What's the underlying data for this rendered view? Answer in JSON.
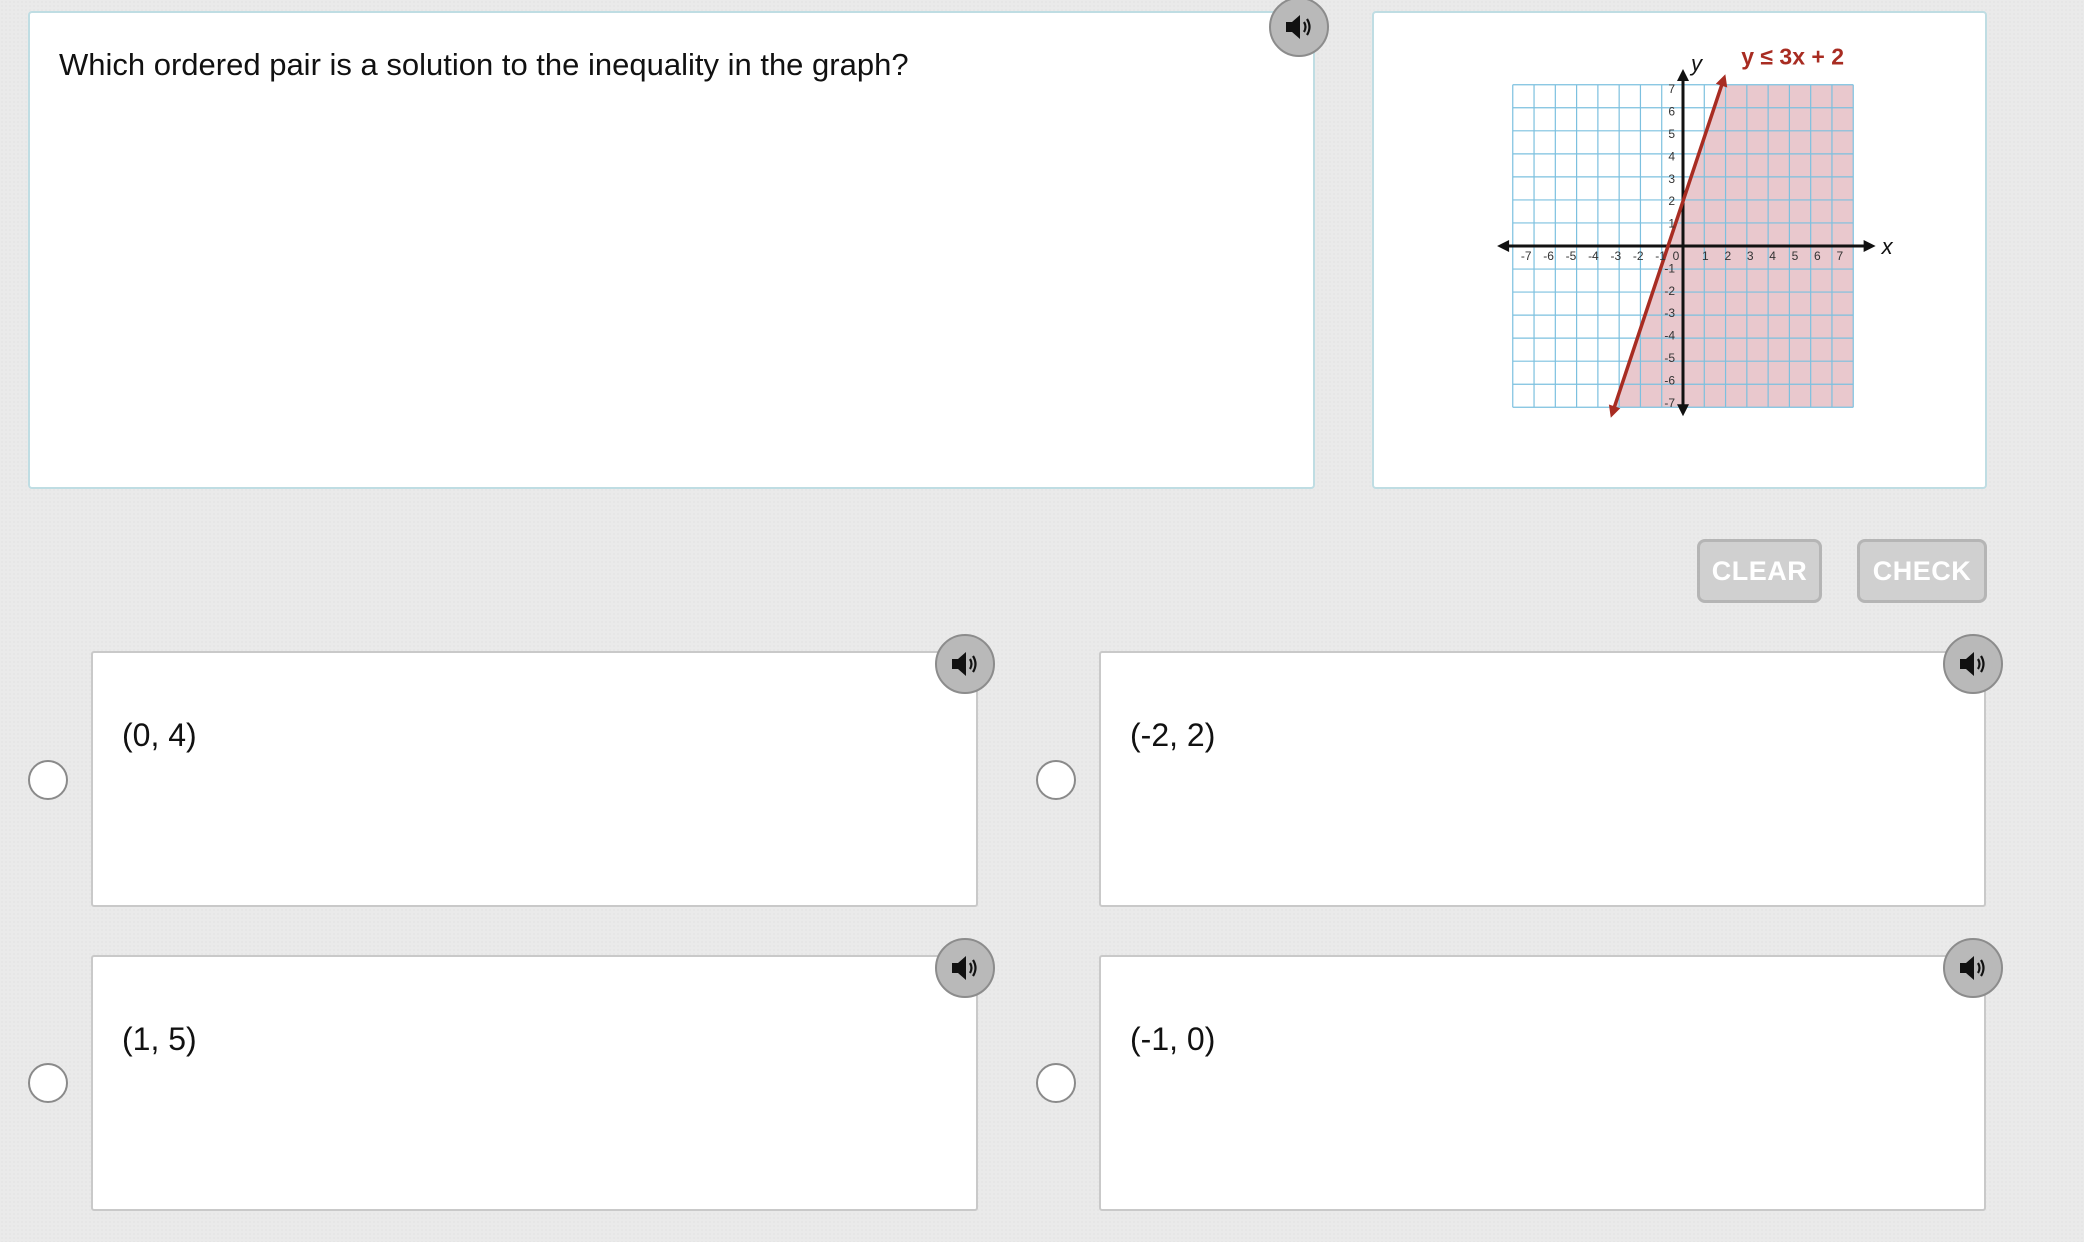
{
  "question": {
    "text": "Which ordered pair is a solution to the inequality in the graph?",
    "audio_icon": "speaker-icon"
  },
  "graph": {
    "inequality_label": "y ≤ 3x + 2",
    "x_axis_label": "x",
    "y_axis_label": "y",
    "x_range": [
      -7,
      7
    ],
    "y_range": [
      -7,
      7
    ],
    "x_ticks": [
      "-7",
      "-6",
      "-5",
      "-4",
      "-3",
      "-2",
      "-1",
      "0",
      "1",
      "2",
      "3",
      "4",
      "5",
      "6",
      "7"
    ],
    "y_ticks": [
      "7",
      "6",
      "5",
      "4",
      "3",
      "2",
      "1",
      "-1",
      "-2",
      "-3",
      "-4",
      "-5",
      "-6",
      "-7"
    ],
    "line": {
      "slope": 3,
      "intercept": 2
    },
    "shaded_region": "below-right of line",
    "colors": {
      "grid": "#7cc0df",
      "shade": "#e9c8cd",
      "line": "#a82c22",
      "axis": "#111111"
    }
  },
  "actions": {
    "clear_label": "CLEAR",
    "check_label": "CHECK"
  },
  "options": [
    {
      "label": "(0, 4)"
    },
    {
      "label": "(-2, 2)"
    },
    {
      "label": "(1, 5)"
    },
    {
      "label": "(-1, 0)"
    }
  ]
}
